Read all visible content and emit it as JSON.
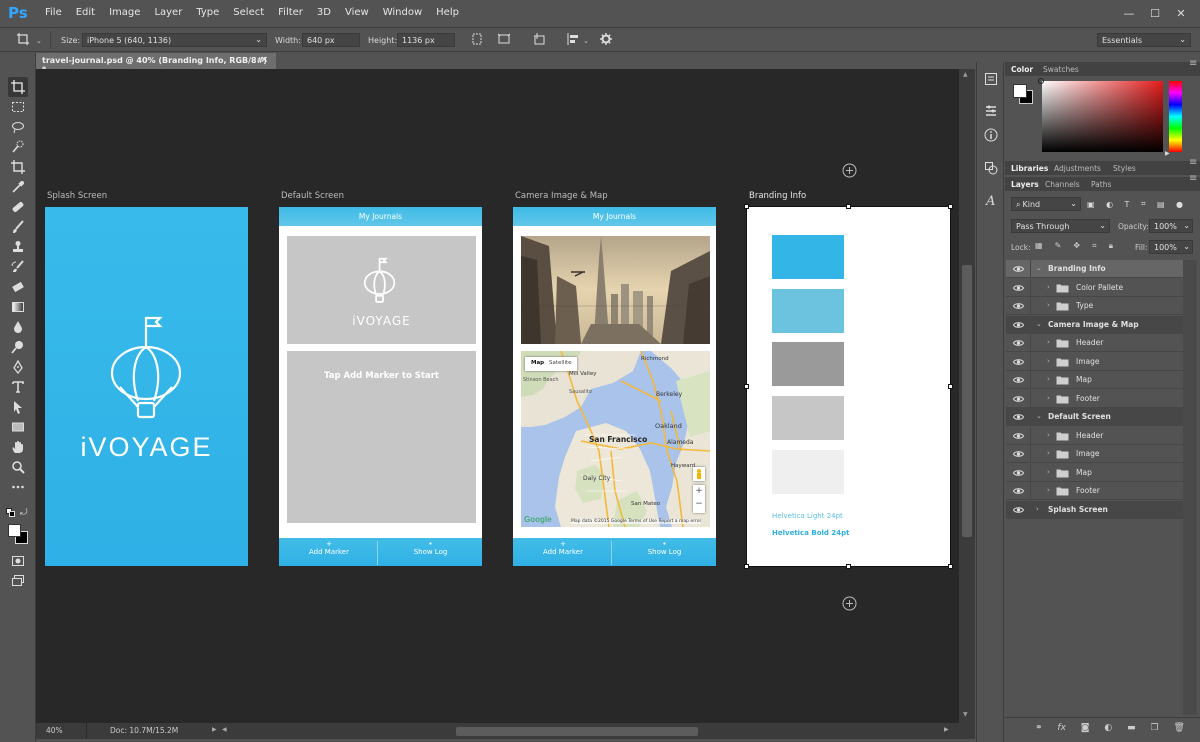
{
  "app": {
    "logo": "Ps"
  },
  "menu": [
    "File",
    "Edit",
    "Image",
    "Layer",
    "Type",
    "Select",
    "Filter",
    "3D",
    "View",
    "Window",
    "Help"
  ],
  "window_controls": {
    "minimize": "—",
    "maximize": "☐",
    "close": "✕"
  },
  "options_bar": {
    "size_label": "Size:",
    "size_value": "iPhone 5 (640, 1136)",
    "width_label": "Width:",
    "width_value": "640 px",
    "height_label": "Height:",
    "height_value": "1136 px",
    "workspace": "Essentials"
  },
  "document_tab": {
    "title": "travel-journal.psd @ 40% (Branding Info, RGB/8#) *",
    "close": "×"
  },
  "artboards": {
    "splash": {
      "label": "Splash Screen",
      "logo_text": "iVOYAGE"
    },
    "default": {
      "label": "Default Screen",
      "header": "My Journals",
      "logo_text": "iVOYAGE",
      "tap_text": "Tap Add Marker to Start",
      "btn_add": "Add Marker",
      "btn_log": "Show Log"
    },
    "camera": {
      "label": "Camera Image & Map",
      "header": "My Journals",
      "btn_add": "Add Marker",
      "btn_log": "Show Log",
      "map": {
        "tab_map": "Map",
        "tab_satellite": "Satellite",
        "places": {
          "mill_valley": "Mill Valley",
          "berkeley": "Berkeley",
          "oakland": "Oakland",
          "san_francisco": "San Francisco",
          "alameda": "Alameda",
          "daly_city": "Daly City",
          "hayward": "Hayward",
          "san_mateo": "San Mateo",
          "richmond": "Richmond",
          "stinson": "Stinson Beach",
          "sausalito": "Sausalito"
        },
        "google": "Google",
        "attribution": "Map data ©2015 Google   Terms of Use   Report a map error",
        "zoom_in": "+",
        "zoom_out": "−"
      }
    },
    "branding": {
      "label": "Branding Info",
      "swatches": [
        "#33b5e8",
        "#6cc3e0",
        "#9a9a9a",
        "#c6c6c6",
        "#efefef"
      ],
      "font_light": "Helvetica Light 24pt",
      "font_bold": "Helvetica Bold 24pt"
    }
  },
  "status": {
    "zoom": "40%",
    "doc": "Doc: 10.7M/15.2M"
  },
  "panels": {
    "color_tabs": [
      "Color",
      "Swatches"
    ],
    "library_tabs": [
      "Libraries",
      "Adjustments",
      "Styles"
    ],
    "layer_tabs": [
      "Layers",
      "Channels",
      "Paths"
    ],
    "kind": "Kind",
    "blend_mode": "Pass Through",
    "opacity_label": "Opacity:",
    "opacity_value": "100%",
    "lock_label": "Lock:",
    "fill_label": "Fill:",
    "fill_value": "100%"
  },
  "layers": [
    {
      "name": "Branding Info",
      "type": "group",
      "open": true
    },
    {
      "name": "Color Pallete",
      "type": "folder"
    },
    {
      "name": "Type",
      "type": "folder"
    },
    {
      "name": "Camera Image & Map",
      "type": "group",
      "open": true
    },
    {
      "name": "Header",
      "type": "folder"
    },
    {
      "name": "Image",
      "type": "folder"
    },
    {
      "name": "Map",
      "type": "folder"
    },
    {
      "name": "Footer",
      "type": "folder"
    },
    {
      "name": "Default Screen",
      "type": "group",
      "open": true
    },
    {
      "name": "Header",
      "type": "folder"
    },
    {
      "name": "Image",
      "type": "folder"
    },
    {
      "name": "Map",
      "type": "folder"
    },
    {
      "name": "Footer",
      "type": "folder"
    },
    {
      "name": "Splash Screen",
      "type": "group",
      "open": false
    }
  ],
  "colors": {
    "accent": "#31a8ff",
    "brand_blue": "#33b5e8",
    "canvas": "#282828",
    "ui": "#535353"
  }
}
